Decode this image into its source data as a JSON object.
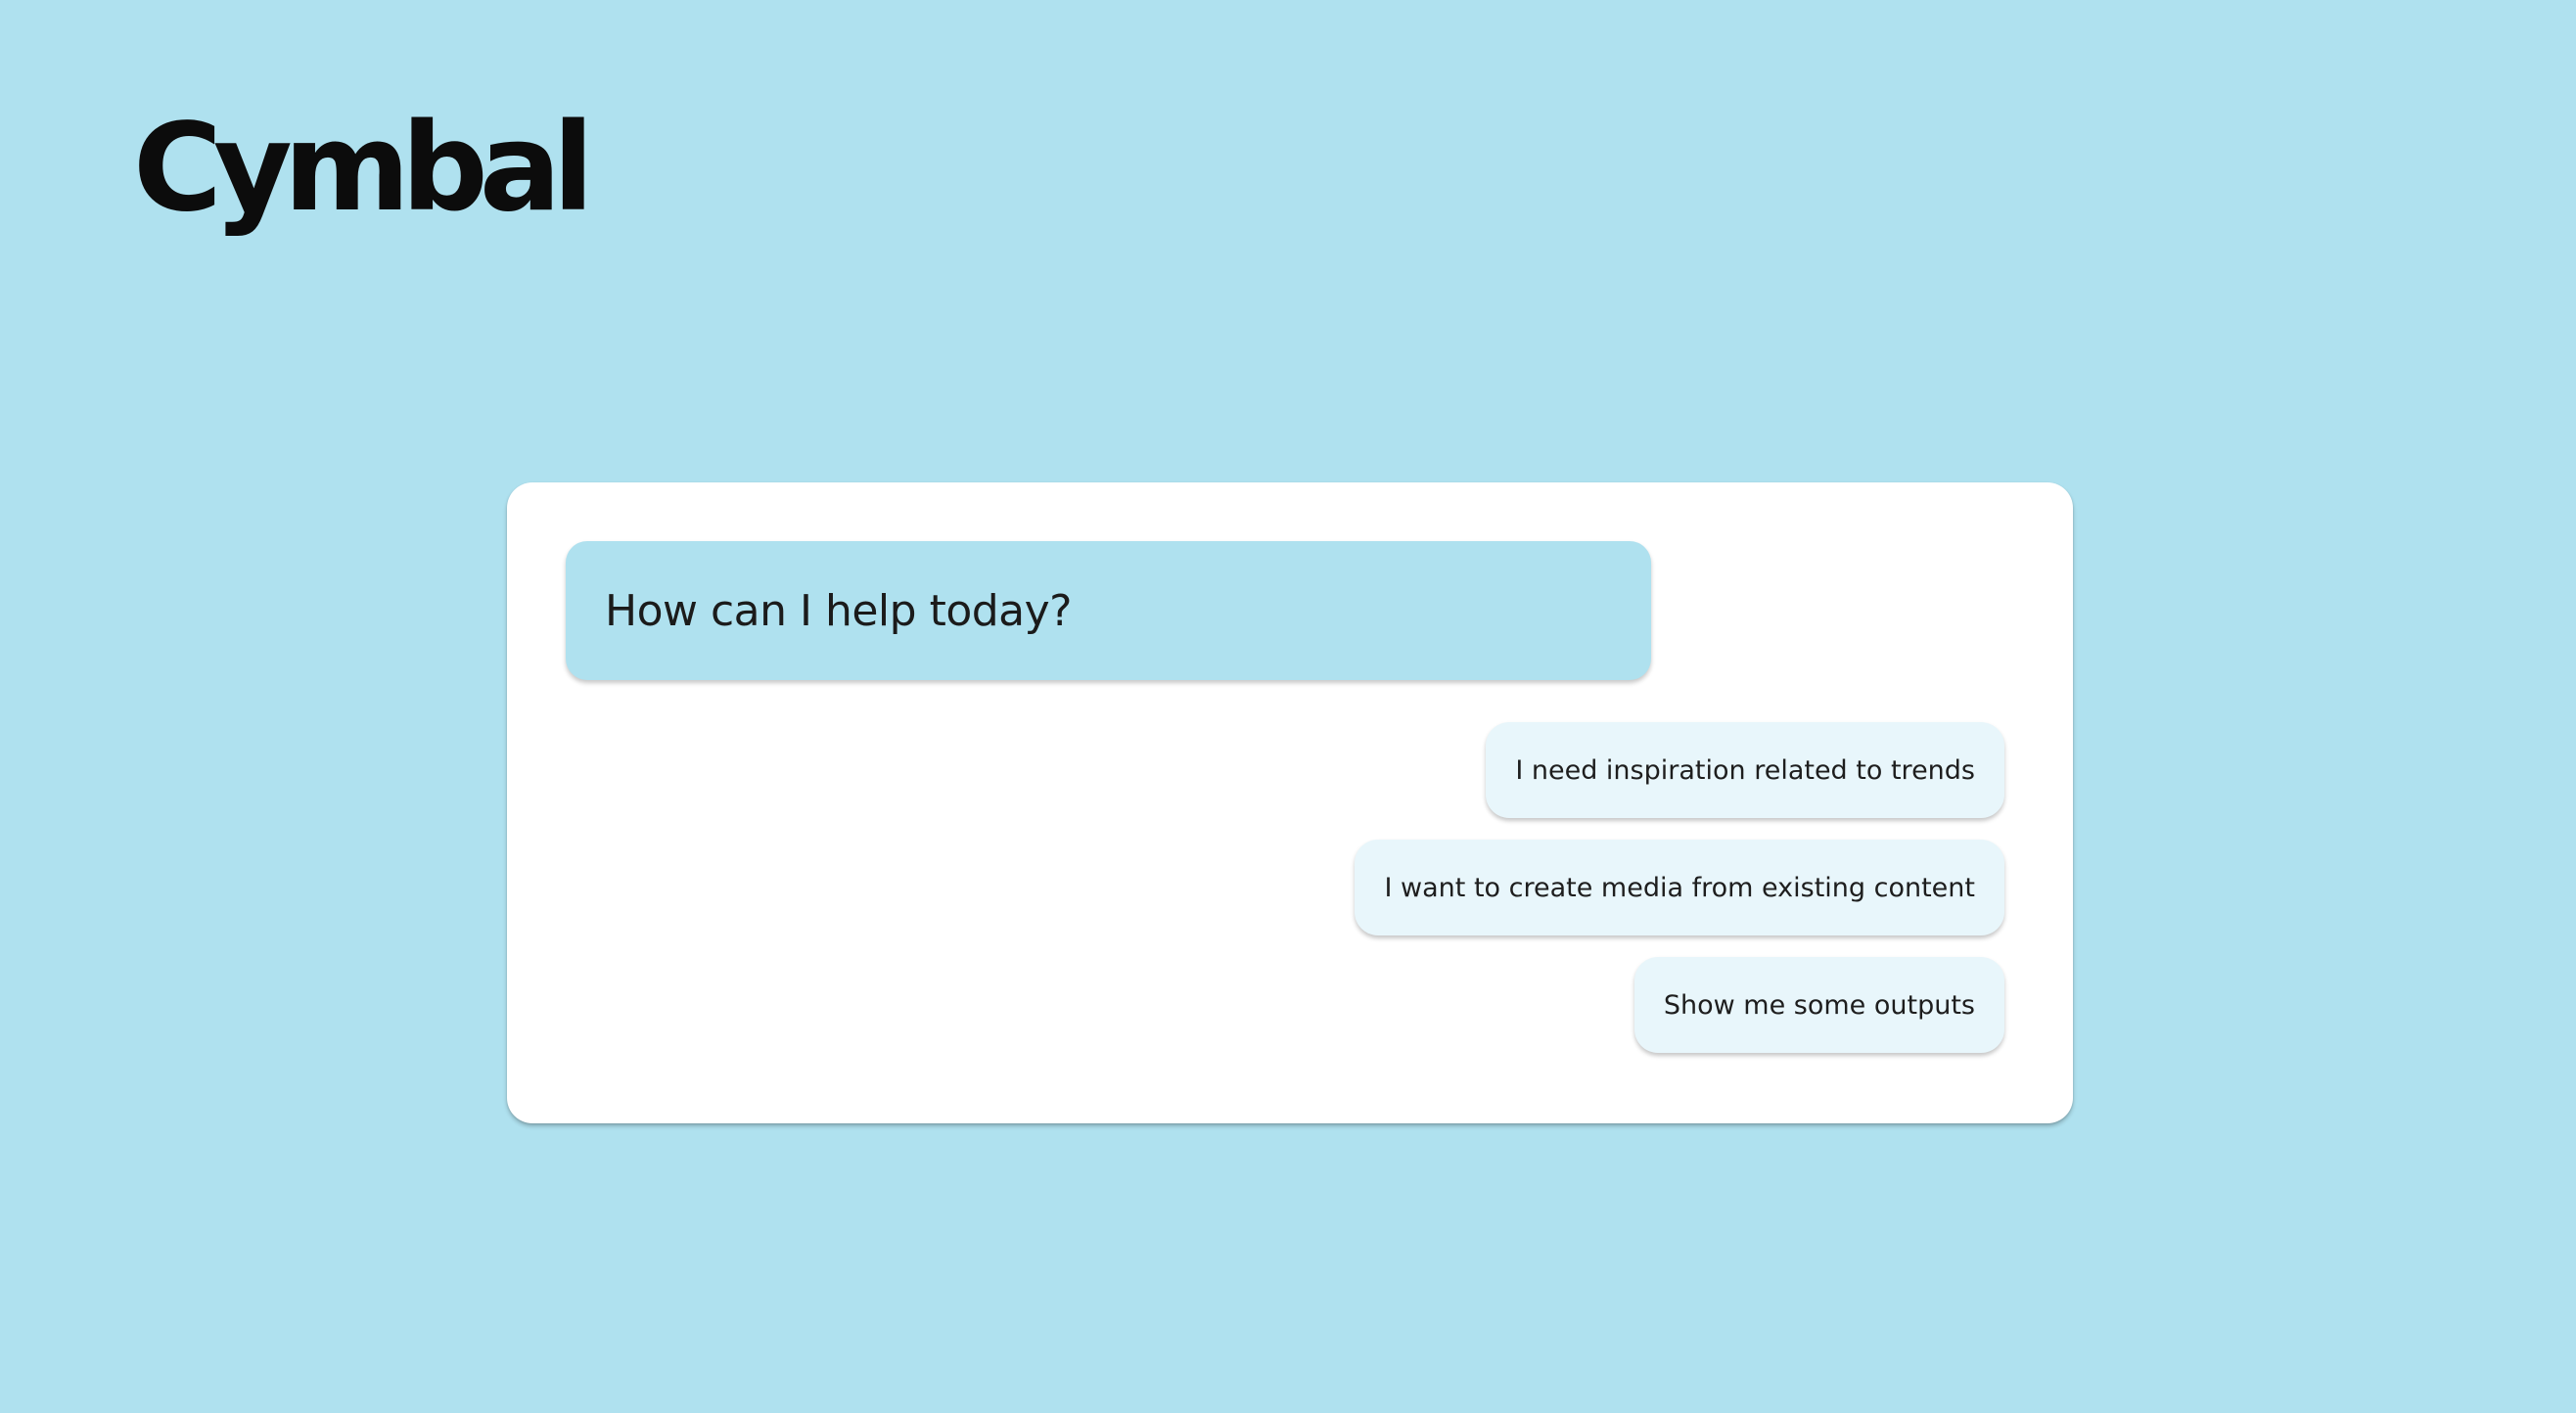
{
  "brand": {
    "logo_text": "Cymbal"
  },
  "chat": {
    "assistant_message": "How can I help today?",
    "suggestions": [
      "I need inspiration related to trends",
      "I want to create media from existing content",
      "Show me some outputs"
    ]
  },
  "colors": {
    "background": "#afe1ef",
    "card": "#ffffff",
    "assistant_bubble": "#afe1ef",
    "suggestion_chip": "#e8f6fb",
    "logo": "#0c0c0c"
  }
}
